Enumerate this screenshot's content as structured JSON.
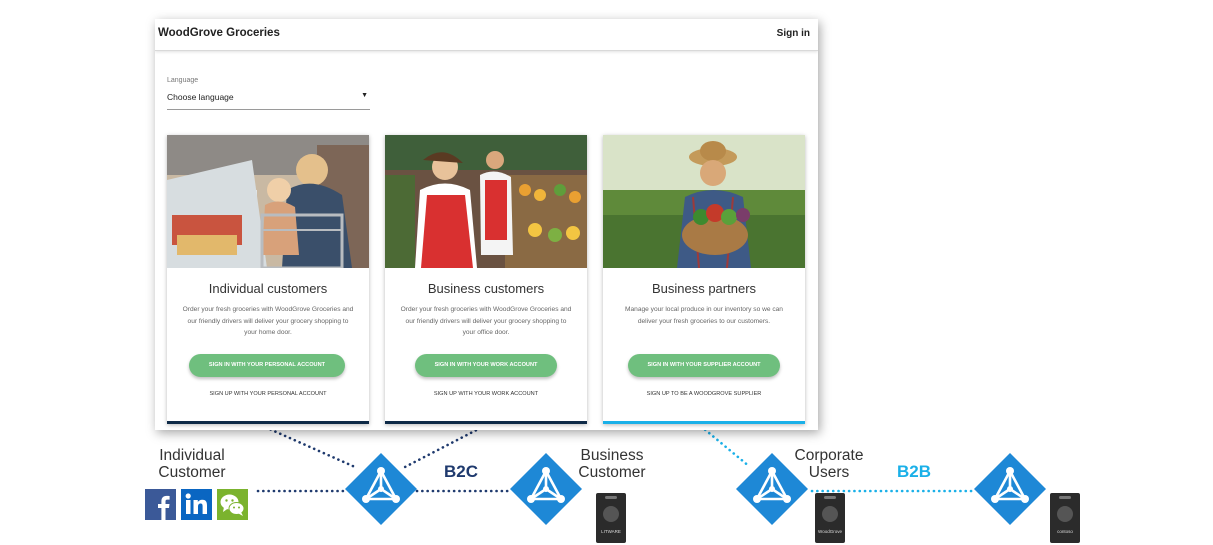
{
  "app": {
    "brand": "WoodGrove Groceries",
    "sign_in": "Sign in",
    "language_label": "Language",
    "language_value": "Choose language",
    "cards": [
      {
        "title": "Individual customers",
        "desc": "Order your fresh groceries with WoodGrove Groceries and our friendly drivers will deliver your grocery shopping to your home door.",
        "button": "SIGN IN WITH YOUR PERSONAL ACCOUNT",
        "link": "SIGN UP WITH YOUR PERSONAL ACCOUNT",
        "bar_color": "#0e2a47"
      },
      {
        "title": "Business customers",
        "desc": "Order your fresh groceries with WoodGrove Groceries and our friendly drivers will deliver your grocery shopping to your office door.",
        "button": "SIGN IN WITH YOUR WORK ACCOUNT",
        "link": "SIGN UP WITH YOUR WORK ACCOUNT",
        "bar_color": "#0e2a47"
      },
      {
        "title": "Business partners",
        "desc": "Manage your local produce in our inventory so we can deliver your fresh groceries to our customers.",
        "button": "SIGN IN WITH YOUR SUPPLIER ACCOUNT",
        "link": "SIGN UP TO BE A WOODGROVE SUPPLIER",
        "bar_color": "#1ab0e8"
      }
    ]
  },
  "diagram": {
    "labels": {
      "individual": "Individual Customer",
      "business": "Business Customer",
      "corporate": "Corporate Users",
      "b2c": "B2C",
      "b2b": "B2B"
    },
    "badges": [
      "LITWARE",
      "WoodGrove",
      "contoso"
    ],
    "social_icons": [
      "facebook-icon",
      "linkedin-icon",
      "wechat-icon"
    ],
    "colors": {
      "azure_blue": "#1e88d6",
      "b2c_text": "#1f3a6e",
      "b2b_text": "#1ab0e8",
      "dotted_dark": "#1f3a6e",
      "dotted_light": "#1ab0e8",
      "button_green": "#6fbf7e"
    }
  }
}
